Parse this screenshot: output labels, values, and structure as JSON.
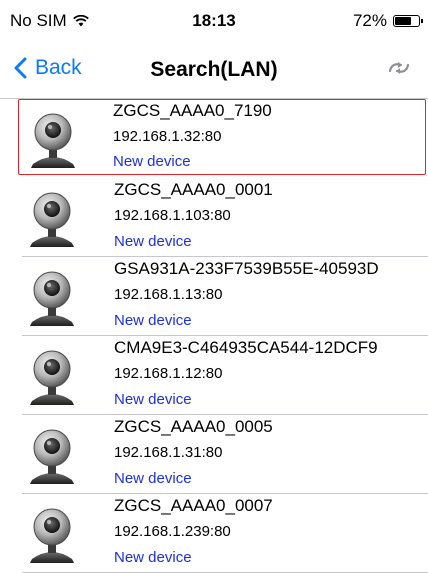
{
  "status_bar": {
    "carrier": "No SIM",
    "time": "18:13",
    "battery": "72%",
    "battery_level": 0.72
  },
  "nav": {
    "back_label": "Back",
    "title": "Search(LAN)"
  },
  "colors": {
    "accent": "#0a7aff",
    "status_text": "#1c2ee8",
    "selection_border": "#e0242b"
  },
  "devices": [
    {
      "name": "ZGCS_AAAA0_7190",
      "address": "192.168.1.32:80",
      "status": "New device",
      "selected": true
    },
    {
      "name": "ZGCS_AAAA0_0001",
      "address": "192.168.1.103:80",
      "status": "New device"
    },
    {
      "name": "GSA931A-233F7539B55E-40593D",
      "address": "192.168.1.13:80",
      "status": "New device"
    },
    {
      "name": "CMA9E3-C464935CA544-12DCF9",
      "address": "192.168.1.12:80",
      "status": "New device"
    },
    {
      "name": "ZGCS_AAAA0_0005",
      "address": "192.168.1.31:80",
      "status": "New device"
    },
    {
      "name": "ZGCS_AAAA0_0007",
      "address": "192.168.1.239:80",
      "status": "New device"
    }
  ]
}
